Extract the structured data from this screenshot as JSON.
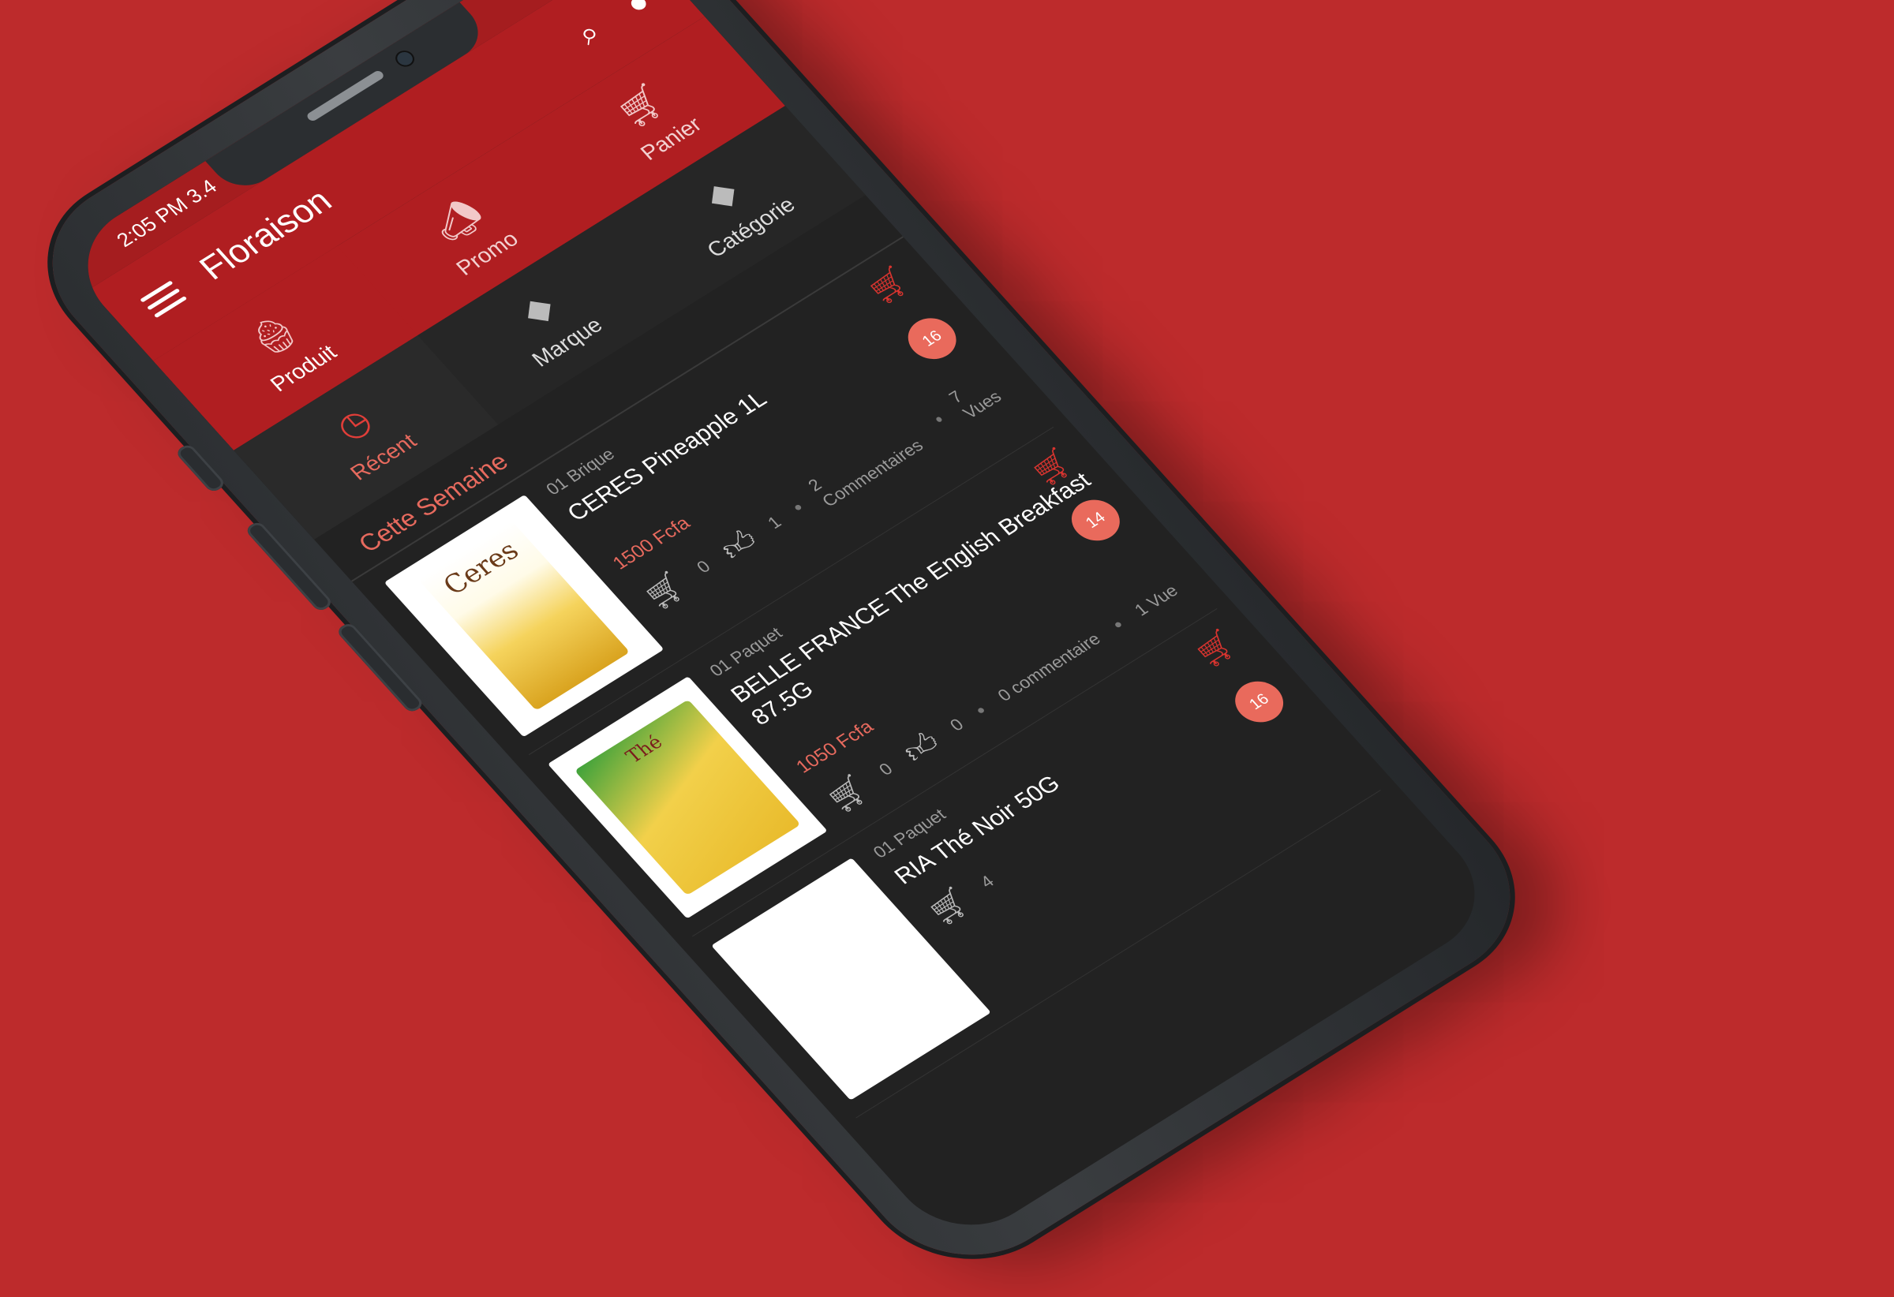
{
  "status": {
    "time": "2:05 PM",
    "speed": "3.4",
    "icons": "▮ ◉ ▲"
  },
  "appbar": {
    "title": "Floraison"
  },
  "topnav": [
    {
      "label": "Produit",
      "icon": "cupcake-icon"
    },
    {
      "label": "Promo",
      "icon": "megaphone-icon"
    },
    {
      "label": "Panier",
      "icon": "cart-icon"
    }
  ],
  "subnav": [
    {
      "label": "Récent",
      "icon": "clock-icon"
    },
    {
      "label": "Marque",
      "icon": "tag-icon"
    },
    {
      "label": "Catégorie",
      "icon": "tag-icon"
    }
  ],
  "section": {
    "title": "Cette Semaine"
  },
  "products": [
    {
      "unit": "01 Brique",
      "name": "CERES Pineapple 1L",
      "price": "1500 Fcfa",
      "cart_count": "0",
      "likes": "1",
      "comments": "2 Commentaires",
      "views": "7 Vues",
      "badge": "16",
      "thumb_label": "Ceres"
    },
    {
      "unit": "01 Paquet",
      "name": "BELLE FRANCE The English Breakfast 87.5G",
      "price": "1050 Fcfa",
      "cart_count": "0",
      "likes": "0",
      "comments": "0 commentaire",
      "views": "1 Vue",
      "badge": "14",
      "thumb_label": "Thé"
    },
    {
      "unit": "01 Paquet",
      "name": "RIA Thé Noir 50G",
      "price": "",
      "cart_count": "4",
      "likes": "",
      "comments": "",
      "views": "",
      "badge": "16",
      "thumb_label": ""
    }
  ],
  "colors": {
    "background": "#bd2b2c",
    "appbar": "#b01e21",
    "accent": "#e76a5e",
    "dark": "#222222"
  }
}
